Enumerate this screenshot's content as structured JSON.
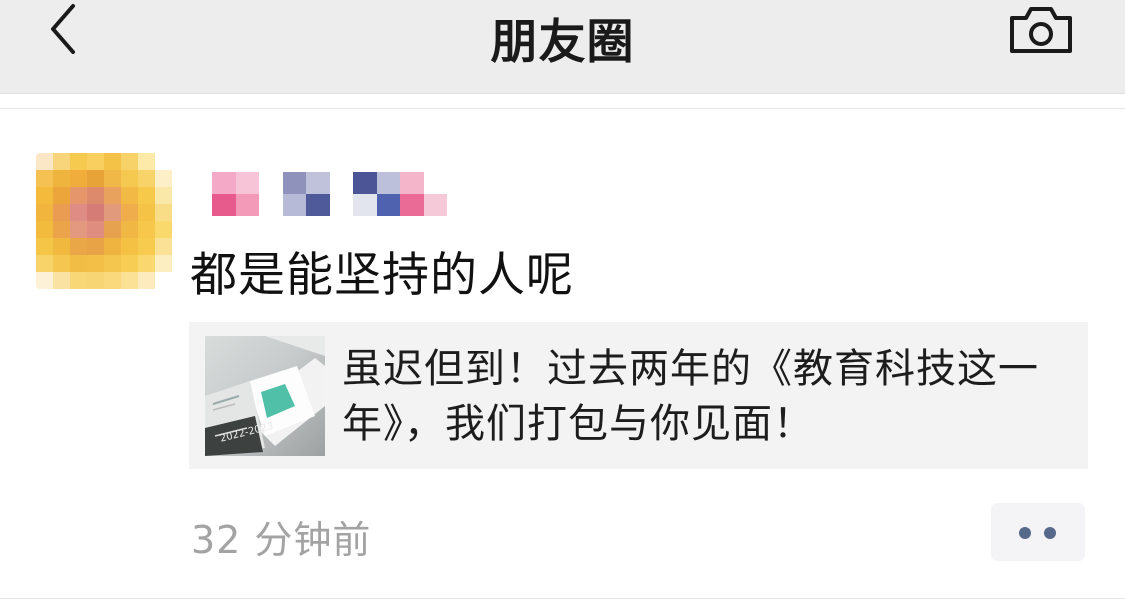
{
  "header": {
    "title": "朋友圈",
    "back_icon": "chevron-left-icon",
    "camera_icon": "camera-icon"
  },
  "post": {
    "text": "都是能坚持的人呢",
    "link_card": {
      "title": "虽迟但到！过去两年的《教育科技这一年》，我们打包与你见面！",
      "thumb_text": "2022-2023"
    },
    "timestamp": "32 分钟前",
    "more_icon": "more-dots-icon"
  },
  "colors": {
    "nav_bg": "#ededed",
    "card_bg": "#f3f3f3",
    "timestamp": "#a3a3a3",
    "more_dots": "#57698a"
  }
}
